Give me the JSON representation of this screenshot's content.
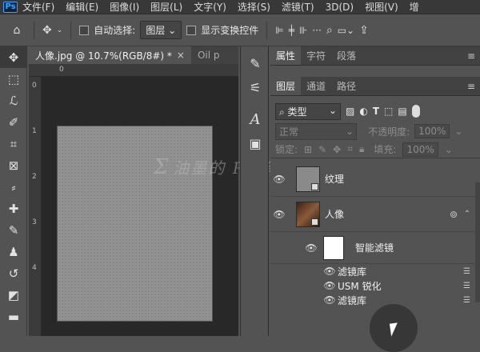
{
  "menubar": {
    "app_icon": "Ps",
    "items": [
      "文件(F)",
      "编辑(E)",
      "图像(I)",
      "图层(L)",
      "文字(Y)",
      "选择(S)",
      "滤镜(T)",
      "3D(D)",
      "视图(V)",
      "增"
    ]
  },
  "options": {
    "auto_select_label": "自动选择:",
    "auto_select_target": "图层",
    "show_transform_label": "显示变换控件"
  },
  "doc_tabs": [
    {
      "label": "人像.jpg @ 10.7%(RGB/8#) *",
      "close": "×"
    },
    {
      "label": "Oil p"
    }
  ],
  "ruler": {
    "h": [
      "0"
    ],
    "v": [
      "0",
      "1",
      "2",
      "3",
      "4"
    ]
  },
  "watermark": "油墨的 PS 笔记",
  "panels": {
    "top_tabs": [
      "属性",
      "字符",
      "段落"
    ],
    "layer_tabs": [
      "图层",
      "通道",
      "路径"
    ],
    "filter_kind": "类型",
    "blend_mode": "正常",
    "opacity_label": "不透明度:",
    "opacity_value": "100%",
    "lock_label": "锁定:",
    "fill_label": "填充:",
    "fill_value": "100%",
    "layers": [
      {
        "name": "纹理"
      },
      {
        "name": "人像"
      },
      {
        "name": "智能滤镜"
      }
    ],
    "filters": [
      {
        "name": "滤镜库"
      },
      {
        "name": "USM 锐化"
      },
      {
        "name": "滤镜库"
      }
    ]
  },
  "icons": {
    "home": "home-icon",
    "move": "move-icon"
  }
}
